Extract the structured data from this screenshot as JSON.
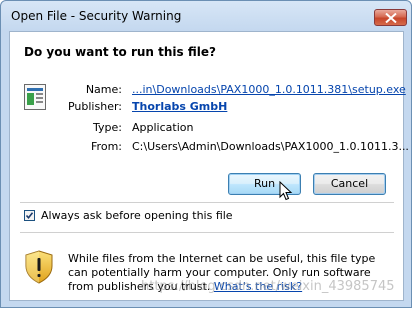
{
  "window": {
    "title": "Open File - Security Warning"
  },
  "question": "Do you want to run this file?",
  "file": {
    "name_label": "Name:",
    "name_value": "...in\\Downloads\\PAX1000_1.0.1011.381\\setup.exe",
    "publisher_label": "Publisher:",
    "publisher_value": "Thorlabs GmbH",
    "type_label": "Type:",
    "type_value": "Application",
    "from_label": "From:",
    "from_value": "C:\\Users\\Admin\\Downloads\\PAX1000_1.0.1011.3..."
  },
  "buttons": {
    "run": "Run",
    "cancel": "Cancel"
  },
  "checkbox": {
    "label": "Always ask before opening this file",
    "checked": true
  },
  "warning": {
    "text": "While files from the Internet can be useful, this file type can potentially harm your computer. Only run software from publishers you trust.",
    "link": "What's the risk?"
  },
  "watermark": "https://blog.csdn.net/weixin_43985745",
  "icons": {
    "close": "close-icon",
    "file": "application-file-icon",
    "shield": "security-shield-icon",
    "cursor": "mouse-pointer-icon"
  }
}
